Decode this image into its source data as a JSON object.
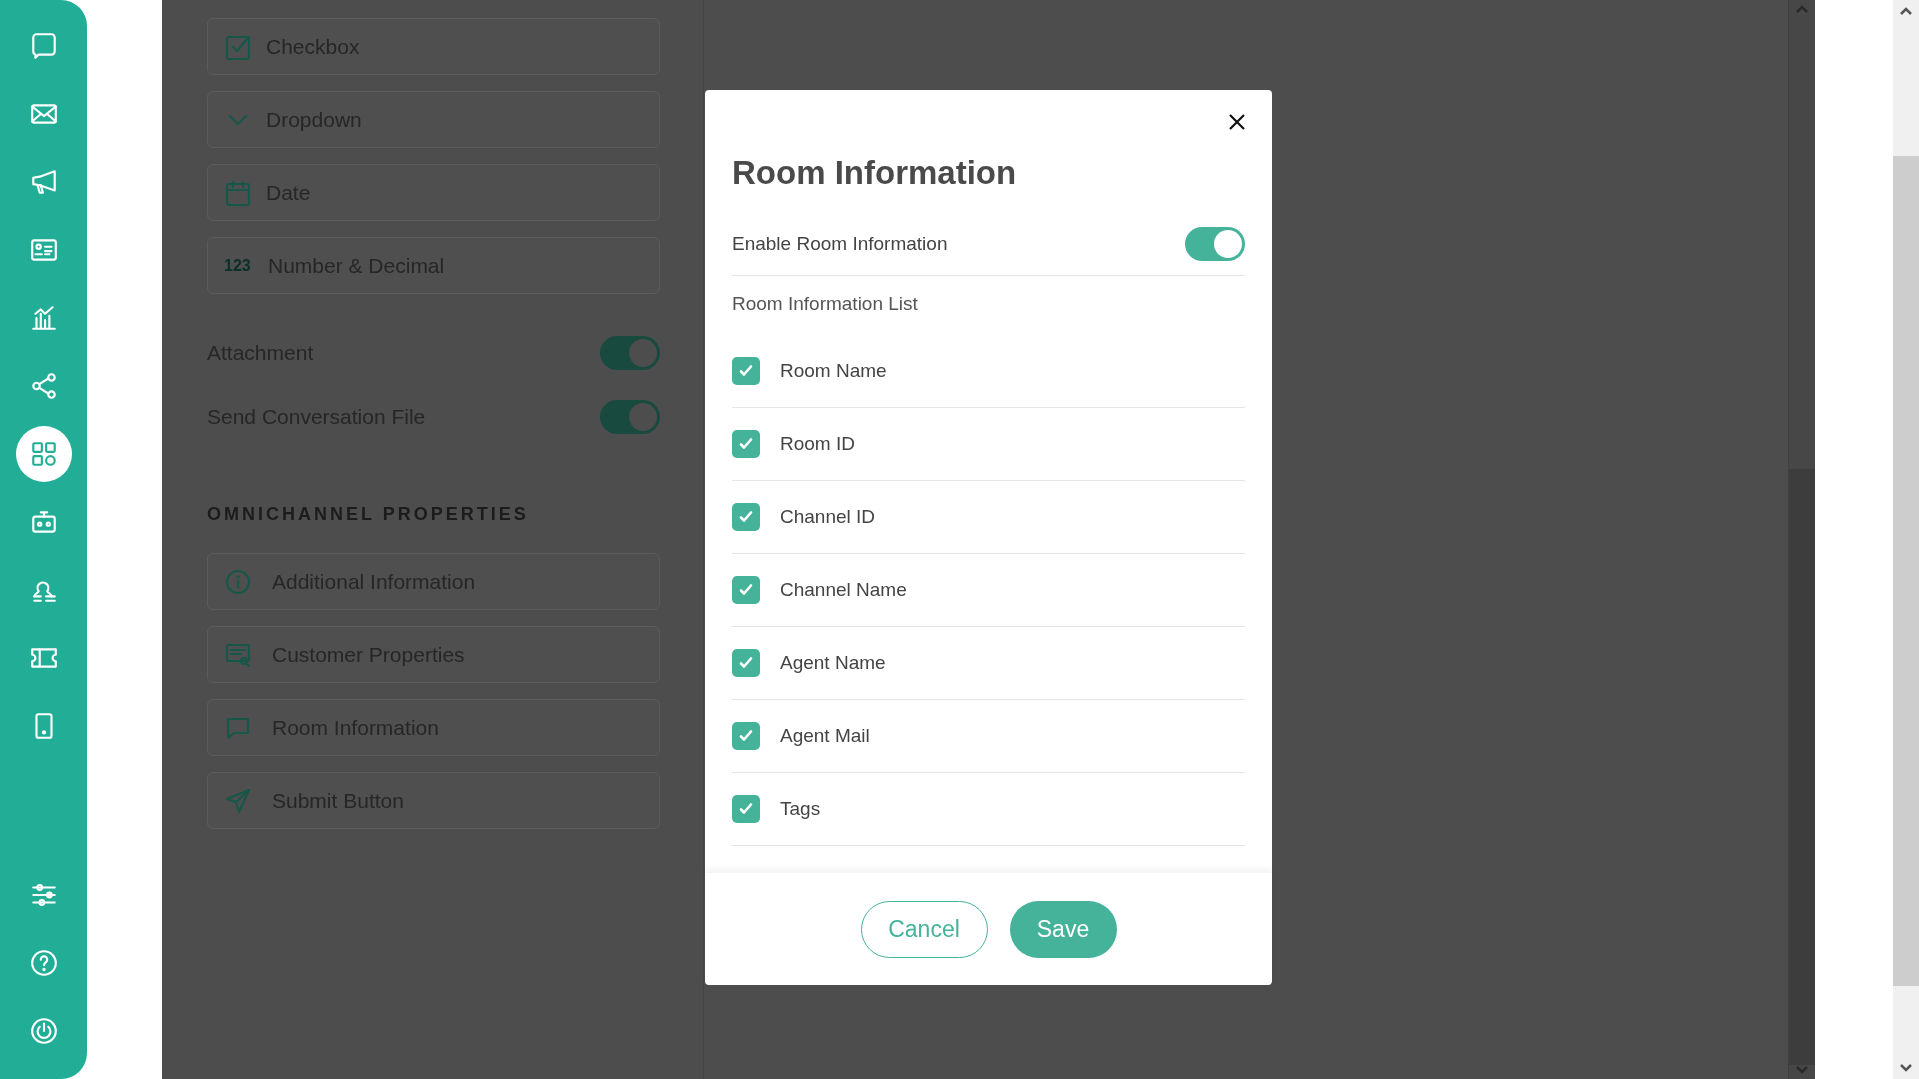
{
  "sidebar": {
    "top_items": [
      {
        "selected": false
      },
      {
        "selected": false
      },
      {
        "selected": false
      },
      {
        "selected": false
      },
      {
        "selected": false
      },
      {
        "selected": false
      },
      {
        "selected": true
      },
      {
        "selected": false
      },
      {
        "selected": false
      },
      {
        "selected": false
      },
      {
        "selected": false
      }
    ],
    "bottom_items": [
      {
        "selected": false
      },
      {
        "selected": false
      },
      {
        "selected": false
      }
    ]
  },
  "field_types": [
    {
      "label": "Checkbox",
      "kind": "checkbox"
    },
    {
      "label": "Dropdown",
      "kind": "dropdown"
    },
    {
      "label": "Date",
      "kind": "date"
    },
    {
      "label": "Number & Decimal",
      "kind": "number",
      "icon_text": "123"
    }
  ],
  "toggles": [
    {
      "label": "Attachment",
      "on": true
    },
    {
      "label": "Send Conversation File",
      "on": true
    }
  ],
  "section_header": "OMNICHANNEL PROPERTIES",
  "properties": [
    {
      "label": "Additional Information",
      "kind": "info"
    },
    {
      "label": "Customer Properties",
      "kind": "customer"
    },
    {
      "label": "Room Information",
      "kind": "room"
    },
    {
      "label": "Submit Button",
      "kind": "submit"
    }
  ],
  "modal": {
    "title": "Room Information",
    "enable": {
      "label": "Enable Room Information",
      "on": true
    },
    "list_label": "Room Information List",
    "items": [
      {
        "label": "Room Name",
        "checked": true
      },
      {
        "label": "Room ID",
        "checked": true
      },
      {
        "label": "Channel ID",
        "checked": true
      },
      {
        "label": "Channel Name",
        "checked": true
      },
      {
        "label": "Agent Name",
        "checked": true
      },
      {
        "label": "Agent Mail",
        "checked": true
      },
      {
        "label": "Tags",
        "checked": true
      }
    ],
    "cancel": "Cancel",
    "save": "Save"
  }
}
